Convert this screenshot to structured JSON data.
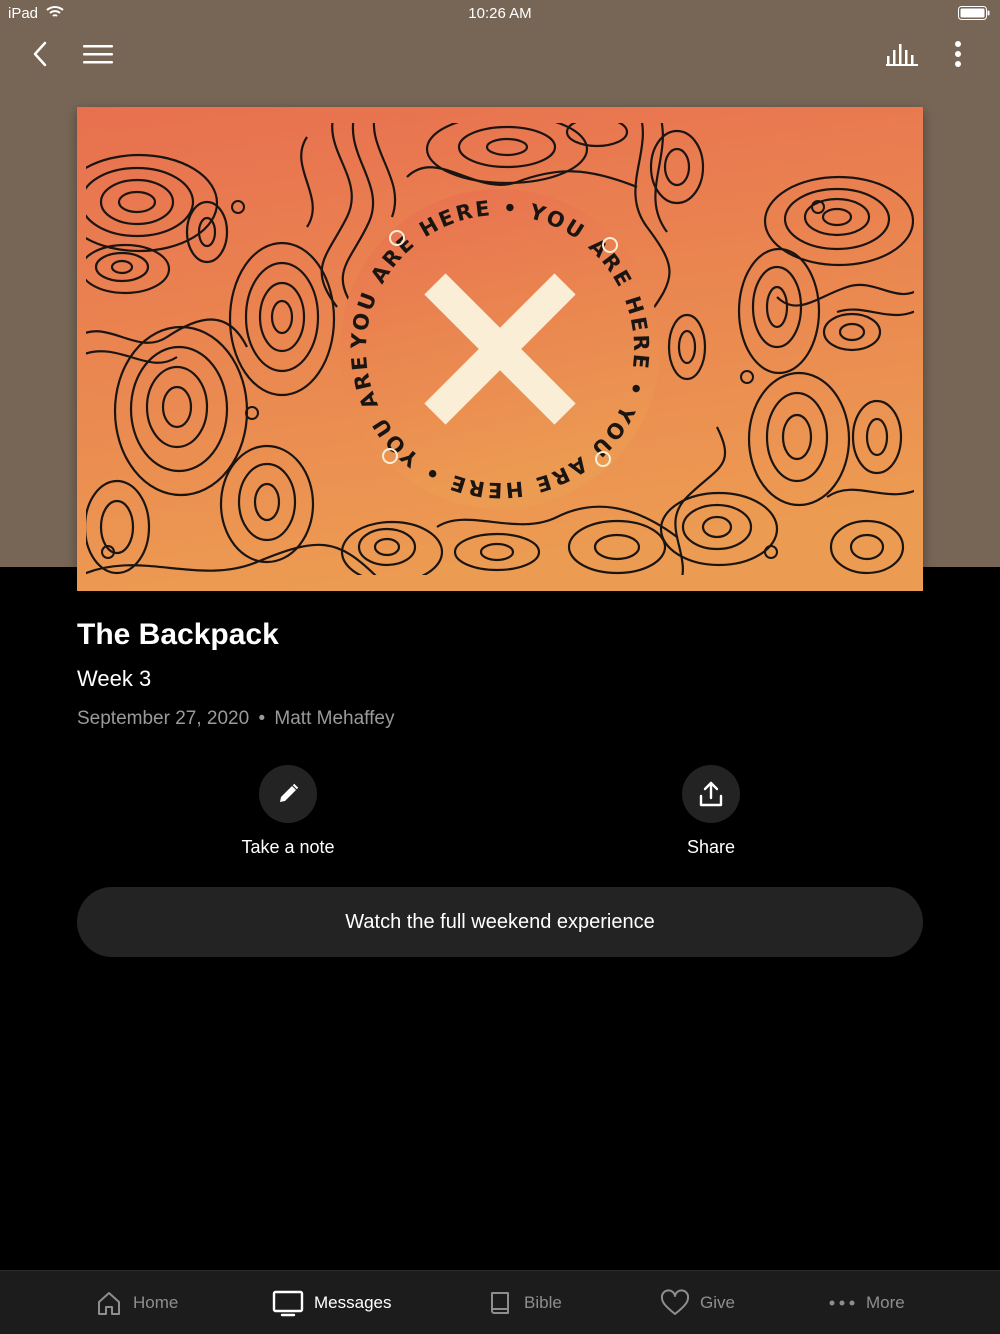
{
  "status_bar": {
    "device": "iPad",
    "time": "10:26 AM"
  },
  "artwork": {
    "ring_text": "YOU ARE HERE • YOU ARE HERE • YOU ARE HERE • YOU ARE HERE •",
    "colors": {
      "top": "#e8704f",
      "bottom": "#ec9b52",
      "mark": "#fbeed6",
      "line": "#1b1512"
    }
  },
  "message": {
    "title": "The Backpack",
    "subtitle": "Week 3",
    "date": "September 27, 2020",
    "separator": "•",
    "speaker": "Matt Mehaffey"
  },
  "actions": {
    "note_label": "Take a note",
    "share_label": "Share",
    "watch_label": "Watch the full weekend experience"
  },
  "tabs": [
    {
      "label": "Home",
      "icon": "home-icon"
    },
    {
      "label": "Messages",
      "icon": "tv-icon",
      "active": true
    },
    {
      "label": "Bible",
      "icon": "book-icon"
    },
    {
      "label": "Give",
      "icon": "heart-icon"
    },
    {
      "label": "More",
      "icon": "ellipsis-icon"
    }
  ],
  "theme": {
    "header_bg": "#776656",
    "page_bg": "#000000",
    "button_bg": "#232323"
  }
}
